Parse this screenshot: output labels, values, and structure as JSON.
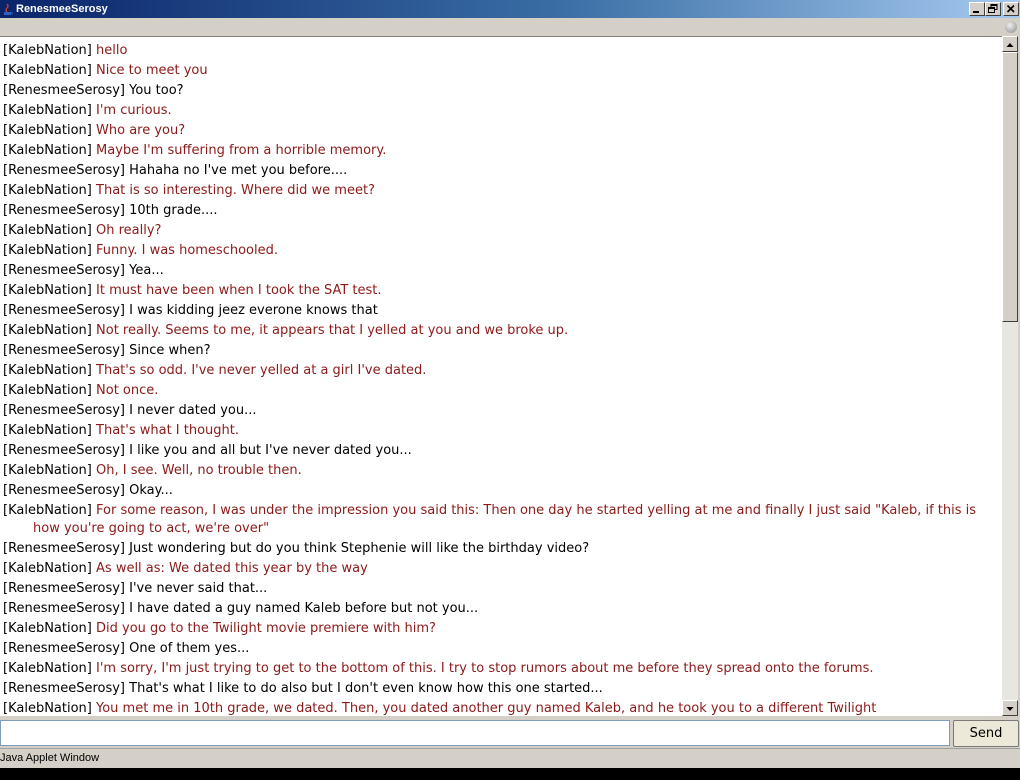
{
  "window": {
    "title": "RenesmeeSerosy",
    "icons": [
      "java-cup-icon",
      "minimize-icon",
      "restore-icon",
      "close-icon"
    ]
  },
  "chat": {
    "messages": [
      {
        "name": "[KalebNation]",
        "text": "hello",
        "from": "other"
      },
      {
        "name": "[KalebNation]",
        "text": "Nice to meet you",
        "from": "other"
      },
      {
        "name": "[RenesmeeSerosy]",
        "text": "You too?",
        "from": "me"
      },
      {
        "name": "[KalebNation]",
        "text": "I'm curious.",
        "from": "other"
      },
      {
        "name": "[KalebNation]",
        "text": "Who are you?",
        "from": "other"
      },
      {
        "name": "[KalebNation]",
        "text": "Maybe I'm suffering from a horrible memory.",
        "from": "other"
      },
      {
        "name": "[RenesmeeSerosy]",
        "text": "Hahaha no I've met you before....",
        "from": "me"
      },
      {
        "name": "[KalebNation]",
        "text": "That is so interesting. Where did we meet?",
        "from": "other"
      },
      {
        "name": "[RenesmeeSerosy]",
        "text": "10th grade....",
        "from": "me"
      },
      {
        "name": "[KalebNation]",
        "text": "Oh really?",
        "from": "other"
      },
      {
        "name": "[KalebNation]",
        "text": "Funny. I was homeschooled.",
        "from": "other"
      },
      {
        "name": "[RenesmeeSerosy]",
        "text": "Yea...",
        "from": "me"
      },
      {
        "name": "[KalebNation]",
        "text": "It must have been when I took the SAT test.",
        "from": "other"
      },
      {
        "name": "[RenesmeeSerosy]",
        "text": "I was kidding jeez everone knows that",
        "from": "me"
      },
      {
        "name": "[KalebNation]",
        "text": "Not really. Seems to me, it appears that I yelled at you and we broke up.",
        "from": "other"
      },
      {
        "name": "[RenesmeeSerosy]",
        "text": "Since when?",
        "from": "me"
      },
      {
        "name": "[KalebNation]",
        "text": "That's so odd. I've never yelled at a girl I've dated.",
        "from": "other"
      },
      {
        "name": "[KalebNation]",
        "text": "Not once.",
        "from": "other"
      },
      {
        "name": "[RenesmeeSerosy]",
        "text": "I never dated you...",
        "from": "me"
      },
      {
        "name": "[KalebNation]",
        "text": "That's what I thought.",
        "from": "other"
      },
      {
        "name": "[RenesmeeSerosy]",
        "text": "I like you and all but I've never dated you...",
        "from": "me"
      },
      {
        "name": "[KalebNation]",
        "text": "Oh, I see. Well, no trouble then.",
        "from": "other"
      },
      {
        "name": "[RenesmeeSerosy]",
        "text": "Okay...",
        "from": "me"
      },
      {
        "name": "[KalebNation]",
        "text": "For some reason, I was under the impression you said this: Then one day he started yelling at me and finally I just said \"Kaleb, if this is how you're going to act, we're over\"",
        "from": "other",
        "wrap": true
      },
      {
        "name": "[RenesmeeSerosy]",
        "text": "Just wondering but do you think Stephenie will like the birthday video?",
        "from": "me"
      },
      {
        "name": "[KalebNation]",
        "text": "As well as: We dated this year by the way",
        "from": "other"
      },
      {
        "name": "[RenesmeeSerosy]",
        "text": "I've never said that...",
        "from": "me"
      },
      {
        "name": "[RenesmeeSerosy]",
        "text": "I have dated a guy named Kaleb before but not you...",
        "from": "me"
      },
      {
        "name": "[KalebNation]",
        "text": "Did you go to the Twilight movie premiere with him?",
        "from": "other"
      },
      {
        "name": "[RenesmeeSerosy]",
        "text": "One of them yes...",
        "from": "me"
      },
      {
        "name": "[KalebNation]",
        "text": "I'm sorry, I'm just trying to get to the bottom of this. I try to stop rumors about me before they spread onto the forums.",
        "from": "other"
      },
      {
        "name": "[RenesmeeSerosy]",
        "text": "That's what I like to do also but I don't even know how this one started...",
        "from": "me"
      },
      {
        "name": "[KalebNation]",
        "text": "You met me in 10th grade, we dated. Then, you dated another guy named Kaleb, and he took you to a different Twilight",
        "from": "other"
      }
    ]
  },
  "input": {
    "value": "",
    "send_label": "Send"
  },
  "status": {
    "text": "Java Applet Window"
  },
  "colors": {
    "other_text": "#8b1a1a",
    "me_text": "#000000",
    "titlebar_start": "#0a246a",
    "titlebar_end": "#a6caf0"
  }
}
